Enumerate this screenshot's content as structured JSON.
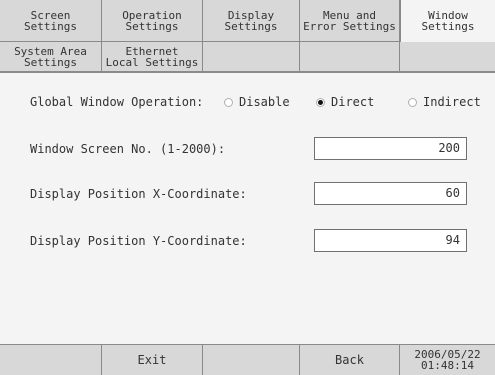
{
  "tabs_row1": [
    {
      "l1": "Screen",
      "l2": "Settings"
    },
    {
      "l1": "Operation",
      "l2": "Settings"
    },
    {
      "l1": "Display",
      "l2": "Settings"
    },
    {
      "l1": "Menu and",
      "l2": "Error Settings"
    },
    {
      "l1": "Window",
      "l2": "Settings"
    }
  ],
  "tabs_row2": [
    {
      "l1": "System Area",
      "l2": "Settings"
    },
    {
      "l1": "Ethernet",
      "l2": "Local Settings"
    }
  ],
  "global": {
    "label": "Global Window Operation:",
    "options": [
      "Disable",
      "Direct",
      "Indirect"
    ],
    "selected": "Direct"
  },
  "fields": {
    "screen_no": {
      "label": "Window Screen No. (1-2000):",
      "value": "200"
    },
    "pos_x": {
      "label": "Display Position X-Coordinate:",
      "value": "60"
    },
    "pos_y": {
      "label": "Display Position Y-Coordinate:",
      "value": "94"
    }
  },
  "bottom": {
    "exit": "Exit",
    "back": "Back",
    "date": "2006/05/22",
    "time": "01:48:14"
  }
}
